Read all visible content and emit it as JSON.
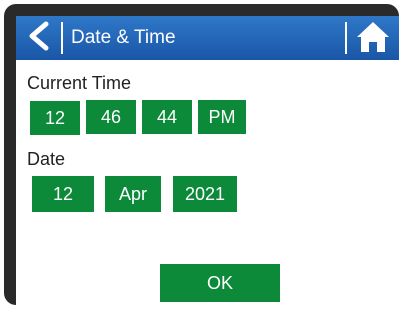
{
  "header": {
    "title": "Date & Time",
    "back_icon": "back-arrow-icon",
    "home_icon": "home-icon"
  },
  "current_time": {
    "label": "Current Time",
    "hour": "12",
    "minute": "46",
    "second": "44",
    "ampm": "PM"
  },
  "date": {
    "label": "Date",
    "day": "12",
    "month": "Apr",
    "year": "2021"
  },
  "actions": {
    "ok_label": "OK"
  },
  "colors": {
    "header_blue": "#1f5fb2",
    "field_green": "#0c8a3a",
    "bezel": "#2a2a2a"
  }
}
